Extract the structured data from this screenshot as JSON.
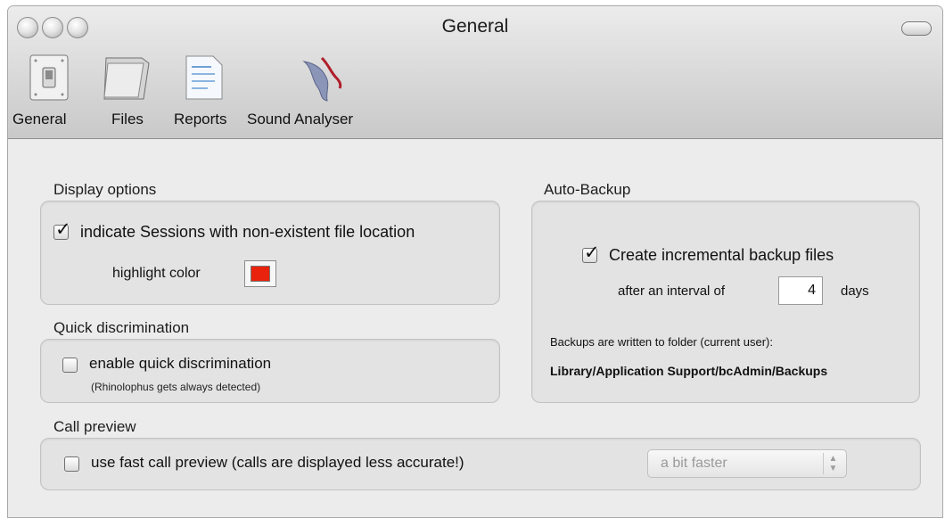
{
  "window": {
    "title": "General"
  },
  "toolbar": {
    "items": [
      {
        "label": "General",
        "icon": "toggle-switch-icon"
      },
      {
        "label": "Files",
        "icon": "folder-icon"
      },
      {
        "label": "Reports",
        "icon": "report-document-icon"
      },
      {
        "label": "Sound Analyser",
        "icon": "bat-sound-icon"
      }
    ]
  },
  "display_options": {
    "title": "Display options",
    "indicate_sessions": {
      "label": "indicate Sessions with non-existent file location",
      "checked": true
    },
    "highlight_color": {
      "label": "highlight color",
      "value": "#e8220c"
    }
  },
  "quick_discrimination": {
    "title": "Quick discrimination",
    "enable": {
      "label": "enable quick discrimination",
      "checked": false
    },
    "note": "(Rhinolophus gets always detected)"
  },
  "auto_backup": {
    "title": "Auto-Backup",
    "create_incremental": {
      "label": "Create incremental backup files",
      "checked": true
    },
    "interval_prefix": "after an interval of",
    "interval_value": "4",
    "interval_unit": "days",
    "folder_info": "Backups are written to folder (current user):",
    "folder_path": "Library/Application Support/bcAdmin/Backups"
  },
  "call_preview": {
    "title": "Call preview",
    "fast_preview": {
      "label": "use fast call preview (calls are displayed less accurate!)",
      "checked": false
    },
    "speed_select": {
      "value": "a bit faster"
    }
  }
}
